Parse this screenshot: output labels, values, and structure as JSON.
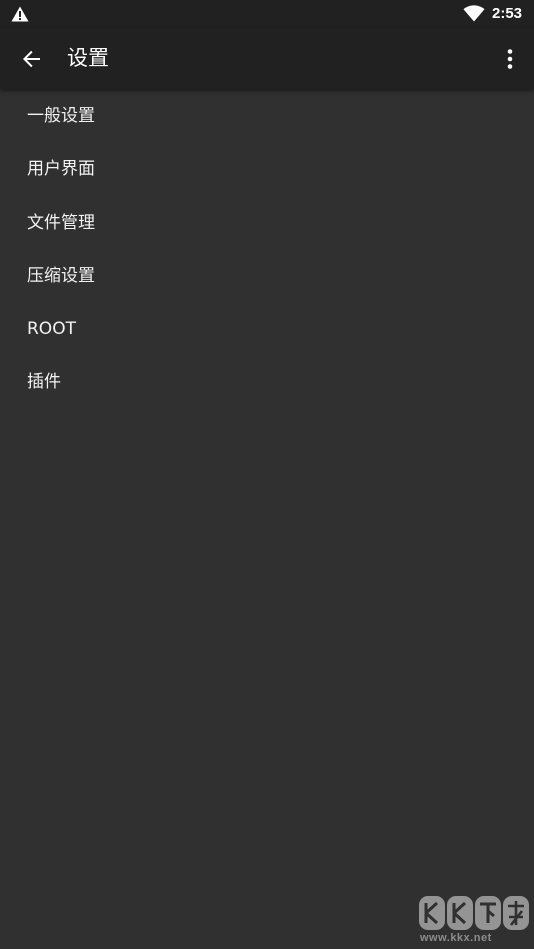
{
  "status_bar": {
    "time": "2:53",
    "icons": [
      "warning-icon",
      "wifi-icon"
    ]
  },
  "toolbar": {
    "title": "设置",
    "back_icon": "arrow-left-icon",
    "menu_icon": "more-vert-icon"
  },
  "settings": {
    "items": [
      {
        "label": "一般设置"
      },
      {
        "label": "用户界面"
      },
      {
        "label": "文件管理"
      },
      {
        "label": "压缩设置"
      },
      {
        "label": "ROOT"
      },
      {
        "label": "插件"
      }
    ]
  },
  "watermark": {
    "logo_text": "KK下载",
    "url": "www.kkx.net"
  },
  "colors": {
    "background": "#303030",
    "toolbar": "#212121",
    "text": "#ffffff"
  }
}
